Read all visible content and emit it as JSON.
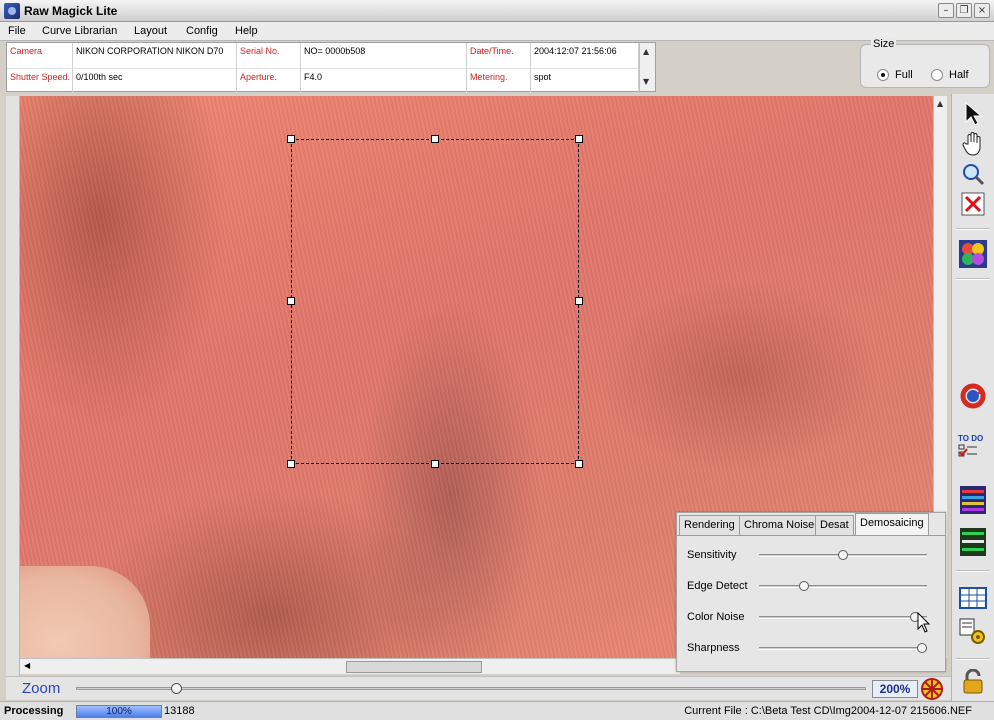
{
  "window": {
    "title": "Raw Magick Lite"
  },
  "menu": [
    "File",
    "Curve Librarian",
    "Layout",
    "Config",
    "Help"
  ],
  "exif": {
    "row1": [
      {
        "label": "Camera",
        "value": "NIKON CORPORATION NIKON D70"
      },
      {
        "label": "Serial No.",
        "value": "NO= 0000b508"
      },
      {
        "label": "Date/Time.",
        "value": "2004:12:07 21:56:06"
      }
    ],
    "row2": [
      {
        "label": "Shutter Speed.",
        "value": "0/100th sec"
      },
      {
        "label": "Aperture.",
        "value": "F4.0"
      },
      {
        "label": "Metering.",
        "value": "spot"
      }
    ]
  },
  "size": {
    "title": "Size",
    "options": [
      {
        "label": "Full",
        "selected": true
      },
      {
        "label": "Half",
        "selected": false
      }
    ]
  },
  "toolbar": {
    "tools": [
      "pointer-icon",
      "hand-icon",
      "zoom-magnifier-icon",
      "delete-x-icon",
      "color-balls-icon",
      "refresh-icon",
      "todo-list-icon",
      "histogram-icon",
      "curves-icon",
      "table-icon",
      "settings-gear-icon",
      "lock-icon"
    ],
    "todo_label": "TO DO"
  },
  "zoom": {
    "label": "Zoom",
    "value": "200%"
  },
  "status": {
    "label": "Processing",
    "progress_text": "100%",
    "progress": 1.0,
    "count": "13188",
    "current_file": "Current File : C:\\Beta Test CD\\Img2004-12-07 215606.NEF"
  },
  "panel": {
    "tabs": [
      {
        "label": "Rendering",
        "active": false
      },
      {
        "label": "Chroma Noise",
        "active": false
      },
      {
        "label": "Desat",
        "active": false
      },
      {
        "label": "Demosaicing",
        "active": true
      }
    ],
    "sliders": [
      {
        "label": "Sensitivity",
        "value": 0.5
      },
      {
        "label": "Edge Detect",
        "value": 0.27
      },
      {
        "label": "Color Noise",
        "value": 0.93
      },
      {
        "label": "Sharpness",
        "value": 0.97
      }
    ]
  },
  "colors": {
    "label_red": "#d21f1f",
    "zoom_blue": "#2b46b8",
    "fabric": "#e5786a"
  }
}
